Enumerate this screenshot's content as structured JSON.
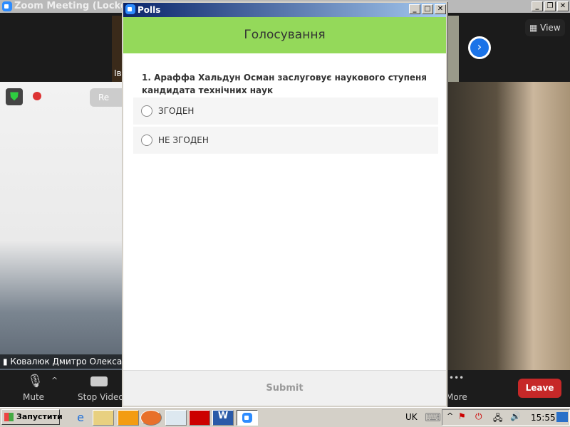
{
  "main_window": {
    "title": "Zoom Meeting (Locked)",
    "participant_top": "Iв",
    "participant_name": "Ковалюк Дмитро Олекса",
    "record_label": "Re",
    "view_label": "View"
  },
  "toolbar": {
    "mute": "Mute",
    "stop_video": "Stop Video",
    "more": "More",
    "leave": "Leave"
  },
  "poll": {
    "window_title": "Polls",
    "header": "Голосування",
    "question": "1. Араффа Хальдун Осман заслуговує наукового ступеня кандидата технічних наук",
    "options": [
      "ЗГОДЕН",
      "НЕ ЗГОДЕН"
    ],
    "submit": "Submit"
  },
  "taskbar": {
    "start": "Запустити",
    "lang": "UK",
    "clock": "15:55"
  },
  "colors": {
    "poll_header": "#94d95a",
    "leave": "#c62828",
    "zoom_blue": "#2d8cff"
  }
}
